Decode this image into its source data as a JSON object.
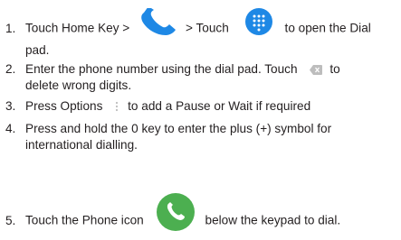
{
  "steps": [
    {
      "num": "1.",
      "text_a": "Touch Home Key >",
      "text_b": "> Touch",
      "text_c": "to open the Dial",
      "text_d": "pad."
    },
    {
      "num": "2.",
      "text_a": "Enter the phone number using the dial pad. Touch",
      "text_b": "to",
      "text_c": "delete wrong digits."
    },
    {
      "num": "3.",
      "text_a": "Press Options",
      "text_b": "to add a Pause or Wait if required"
    },
    {
      "num": "4.",
      "text_a": "Press and hold the 0 key to enter the plus (+) symbol for",
      "text_b": "international dialling."
    },
    {
      "num": "5.",
      "text_a": "Touch the Phone icon",
      "text_b": "below the keypad to dial."
    }
  ],
  "icons": {
    "phone_handset": "phone-handset-icon",
    "dialpad": "dialpad-icon",
    "backspace": "backspace-icon",
    "options": "options-icon",
    "phone_button": "phone-button-icon"
  },
  "colors": {
    "text": "#231f20",
    "phone_blue": "#1e88e5",
    "dialpad_blue": "#1e88e5",
    "phone_green": "#4caf50",
    "icon_grey": "#bdbdbd"
  }
}
